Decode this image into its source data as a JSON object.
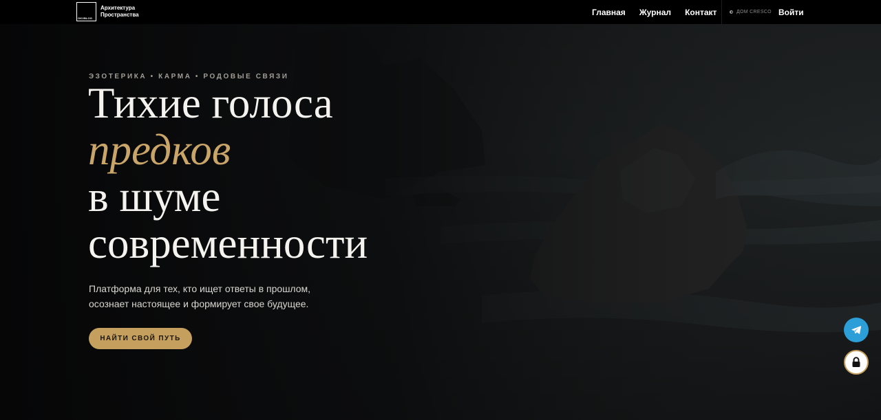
{
  "header": {
    "logo_mark": "OKVBLOG",
    "logo_line1": "Архитектура",
    "logo_line2": "Пространства",
    "nav": [
      {
        "label": "Главная"
      },
      {
        "label": "Журнал"
      },
      {
        "label": "Контакт"
      }
    ],
    "brand_label": "ДОМ CRESCO",
    "brand_icon": "half-circle-icon",
    "login_label": "Войти"
  },
  "hero": {
    "kicker": "ЭЗОТЕРИКА • КАРМА • РОДОВЫЕ СВЯЗИ",
    "title_line1": "Тихие голоса",
    "title_accent": "предков",
    "title_line3": "в шуме",
    "title_line4": "современности",
    "subtitle_line1": "Платформа для тех, кто ищет ответы в прошлом,",
    "subtitle_line2": "осознает настоящее и формирует свое будущее.",
    "cta_label": "НАЙТИ СВОЙ ПУТЬ"
  },
  "floating": {
    "telegram_icon": "telegram-icon",
    "lock_icon": "lock-icon"
  },
  "colors": {
    "accent": "#c49f5e",
    "title_accent": "#c9a56a",
    "background": "#0b0b0c",
    "telegram": "#2c9ed8"
  }
}
